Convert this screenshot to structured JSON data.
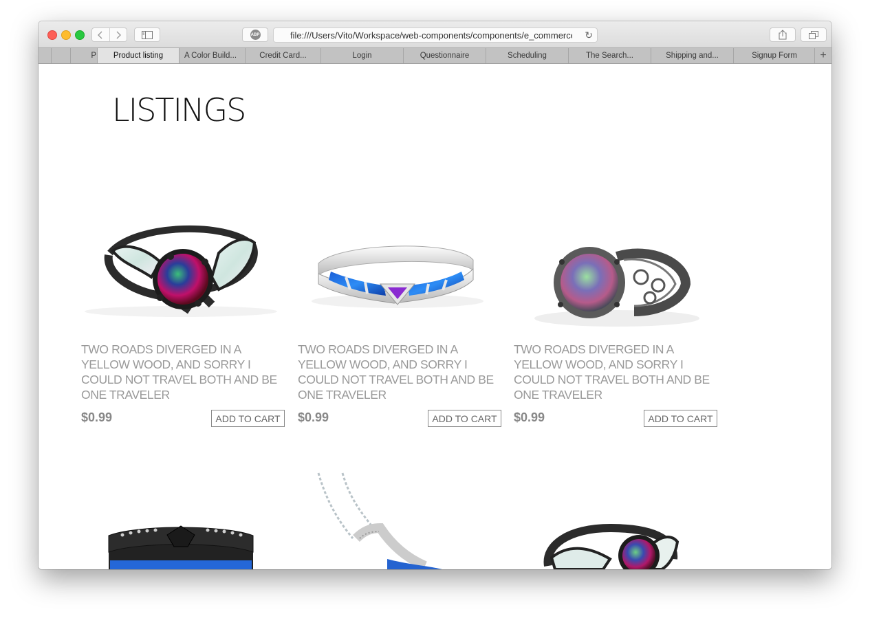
{
  "browser": {
    "url": "file:///Users/Vito/Workspace/web-components/components/e_commerce_",
    "abp_label": "ABP",
    "tabs": [
      {
        "label": "P"
      },
      {
        "label": "Product listing"
      },
      {
        "label": "A Color Build..."
      },
      {
        "label": "Credit Card..."
      },
      {
        "label": "Login"
      },
      {
        "label": "Questionnaire"
      },
      {
        "label": "Scheduling"
      },
      {
        "label": "The Search..."
      },
      {
        "label": "Shipping and..."
      },
      {
        "label": "Signup Form"
      }
    ],
    "new_tab_label": "+"
  },
  "page": {
    "title": "LISTINGS",
    "products": [
      {
        "description": "TWO ROADS DIVERGED IN A YELLOW WOOD, AND SORRY I COULD NOT TRAVEL BOTH AND BE ONE TRAVELER",
        "price": "$0.99",
        "button": "ADD TO CART",
        "image": "black-ring-opal-icon"
      },
      {
        "description": "TWO ROADS DIVERGED IN A YELLOW WOOD, AND SORRY I COULD NOT TRAVEL BOTH AND BE ONE TRAVELER",
        "price": "$0.99",
        "button": "ADD TO CART",
        "image": "silver-bangle-icon"
      },
      {
        "description": "TWO ROADS DIVERGED IN A YELLOW WOOD, AND SORRY I COULD NOT TRAVEL BOTH AND BE ONE TRAVELER",
        "price": "$0.99",
        "button": "ADD TO CART",
        "image": "filigree-ring-icon"
      }
    ],
    "more_products": [
      {
        "image": "black-band-ring-icon"
      },
      {
        "image": "silver-necklace-icon"
      },
      {
        "image": "black-ring-opal-icon"
      }
    ]
  }
}
